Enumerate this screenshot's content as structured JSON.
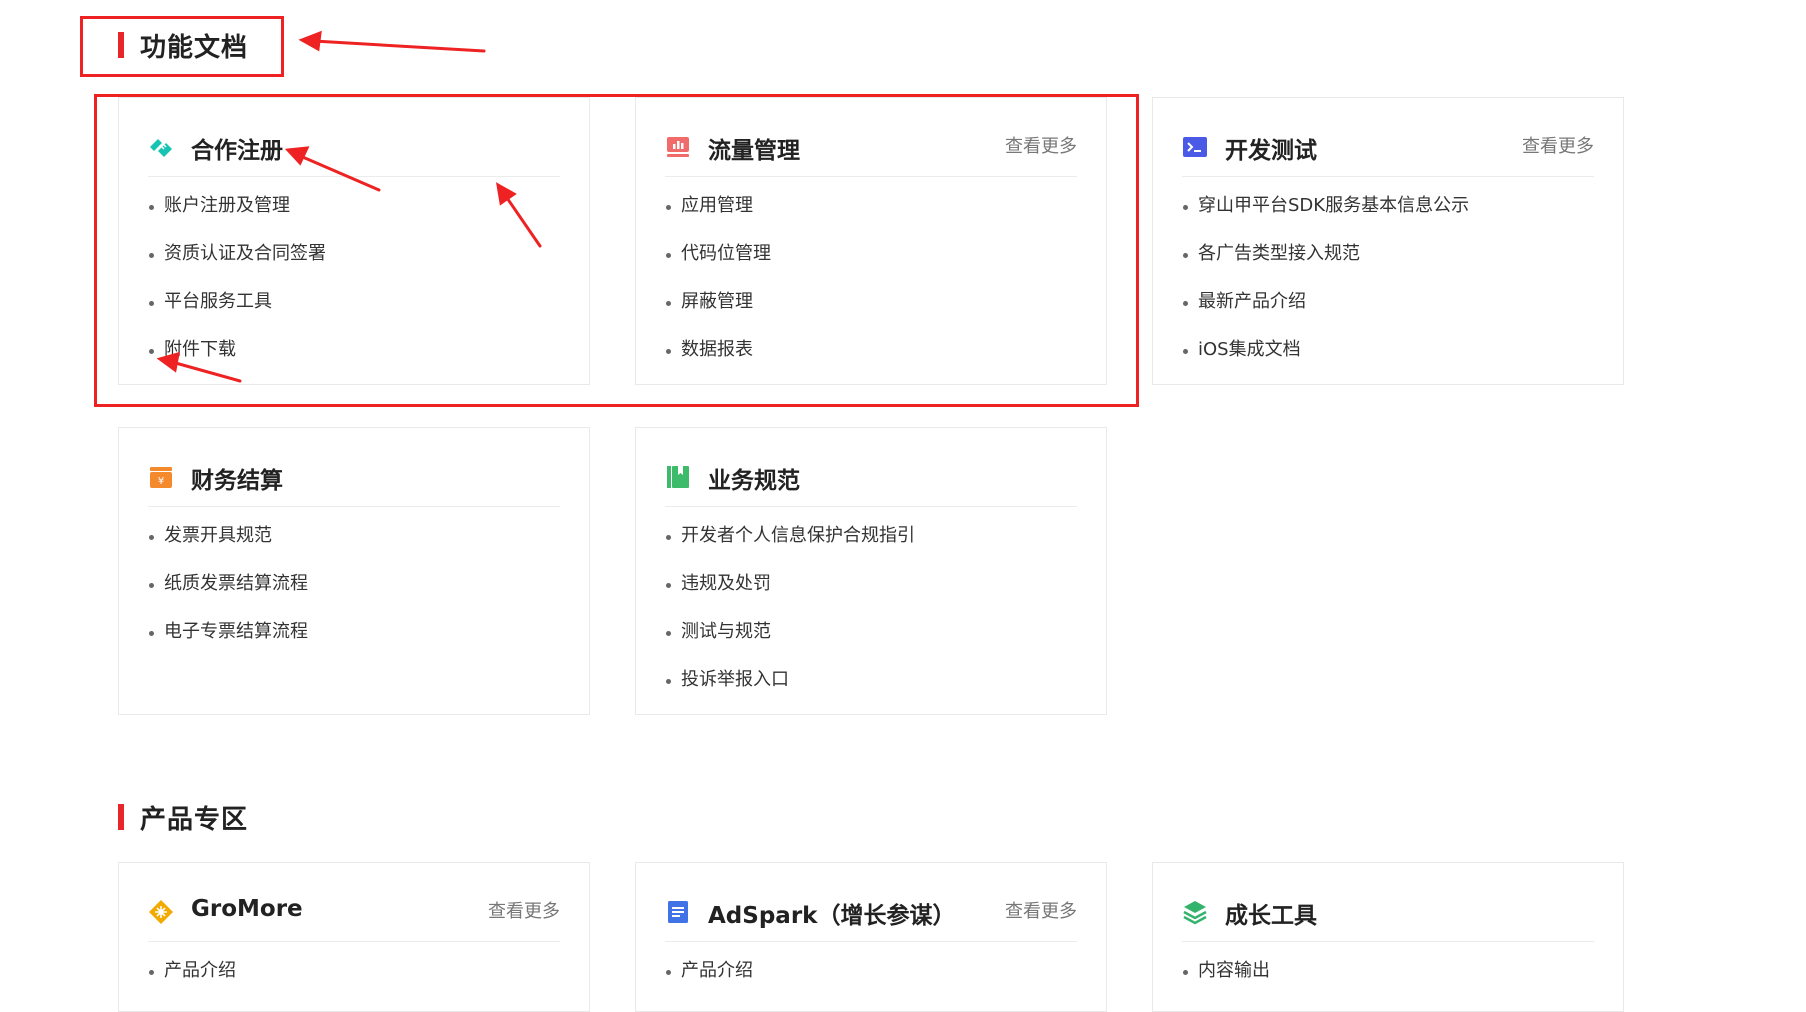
{
  "sections": {
    "docs_title": "功能文档",
    "products_title": "产品专区"
  },
  "more_label": "查看更多",
  "cards": {
    "register": {
      "title": "合作注册",
      "icon": "handshake-icon",
      "items": [
        "账户注册及管理",
        "资质认证及合同签署",
        "平台服务工具",
        "附件下载"
      ]
    },
    "traffic": {
      "title": "流量管理",
      "icon": "chart-icon",
      "items": [
        "应用管理",
        "代码位管理",
        "屏蔽管理",
        "数据报表"
      ]
    },
    "devtest": {
      "title": "开发测试",
      "icon": "terminal-icon",
      "items": [
        "穿山甲平台SDK服务基本信息公示",
        "各广告类型接入规范",
        "最新产品介绍",
        "iOS集成文档"
      ]
    },
    "finance": {
      "title": "财务结算",
      "icon": "wallet-icon",
      "items": [
        "发票开具规范",
        "纸质发票结算流程",
        "电子专票结算流程"
      ]
    },
    "rules": {
      "title": "业务规范",
      "icon": "book-icon",
      "items": [
        "开发者个人信息保护合规指引",
        "违规及处罚",
        "测试与规范",
        "投诉举报入口"
      ]
    },
    "gromore": {
      "title": "GroMore",
      "icon": "diamond-icon",
      "items": [
        "产品介绍"
      ]
    },
    "adspark": {
      "title": "AdSpark（增长参谋）",
      "icon": "document-icon",
      "items": [
        "产品介绍"
      ]
    },
    "growth": {
      "title": "成长工具",
      "icon": "layers-icon",
      "items": [
        "内容输出"
      ]
    }
  },
  "colors": {
    "accent_red": "#e8262a",
    "annotation_red": "#ee2222",
    "teal": "#17c3b2",
    "coral": "#f26b6b",
    "indigo": "#4b5ae6",
    "orange": "#f58a2c",
    "green": "#3dbb6a",
    "gold": "#f2a900",
    "blue": "#3f73e6",
    "emerald": "#33b36b"
  }
}
